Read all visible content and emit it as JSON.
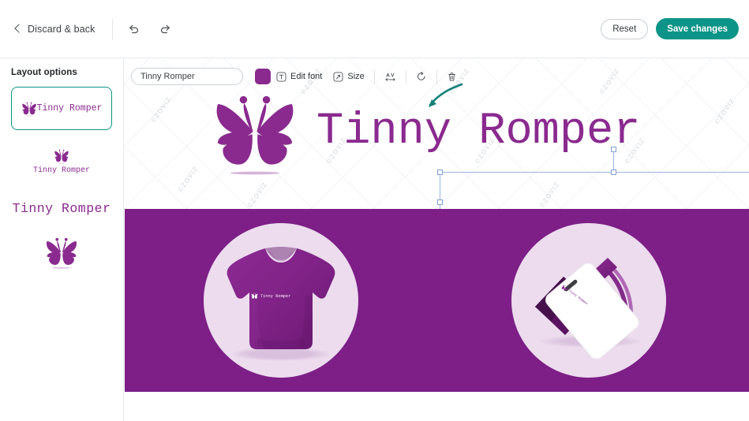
{
  "app": {
    "brand_name": "Tinny Romper",
    "colors": {
      "brand_purple": "#8a2a8f",
      "banner_purple": "#7d1f87",
      "accent_teal": "#0d9488",
      "circle_lavender": "#ecdcee",
      "selection_blue": "#9bb4e0"
    }
  },
  "topbar": {
    "back_label": "Discard & back",
    "back_icon": "chevron-left-icon",
    "undo_icon": "undo-icon",
    "redo_icon": "redo-icon",
    "reset_label": "Reset",
    "save_label": "Save changes"
  },
  "sidebar": {
    "title": "Layout options",
    "items": [
      {
        "label": "Tinny Romper",
        "variant": "icon-left-text",
        "selected": true
      },
      {
        "label": "Tinny Romper",
        "variant": "icon-above-text",
        "selected": false
      },
      {
        "label": "Tinny Romper",
        "variant": "text-only",
        "selected": false
      },
      {
        "label": "",
        "variant": "icon-only",
        "selected": false
      }
    ]
  },
  "toolbar": {
    "name_value": "Tinny Romper",
    "name_placeholder": "Tinny Romper",
    "color_swatch": "#8a2a8f",
    "edit_font_label": "Edit font",
    "edit_font_icon": "text-box-icon",
    "size_label": "Size",
    "size_icon": "resize-arrow-icon",
    "letter_spacing_icon": "letter-spacing-icon",
    "rotate_icon": "rotate-icon",
    "delete_icon": "trash-icon"
  },
  "canvas": {
    "logo_text": "Tinny Romper",
    "logo_icon": "butterfly-icon",
    "watermark_text": "©ZOVIZ",
    "annotation_icon": "curved-arrow-icon",
    "selection": {
      "handle_count": 8,
      "rotate_handle": "rotate-handle"
    }
  },
  "banner": {
    "mockups": [
      {
        "name": "tshirt-mockup",
        "logo_text": "Tinny Romper",
        "logo_icon": "butterfly-icon"
      },
      {
        "name": "id-badge-mockup",
        "logo_text": "Tinny Romper",
        "logo_icon": "butterfly-icon"
      }
    ]
  }
}
